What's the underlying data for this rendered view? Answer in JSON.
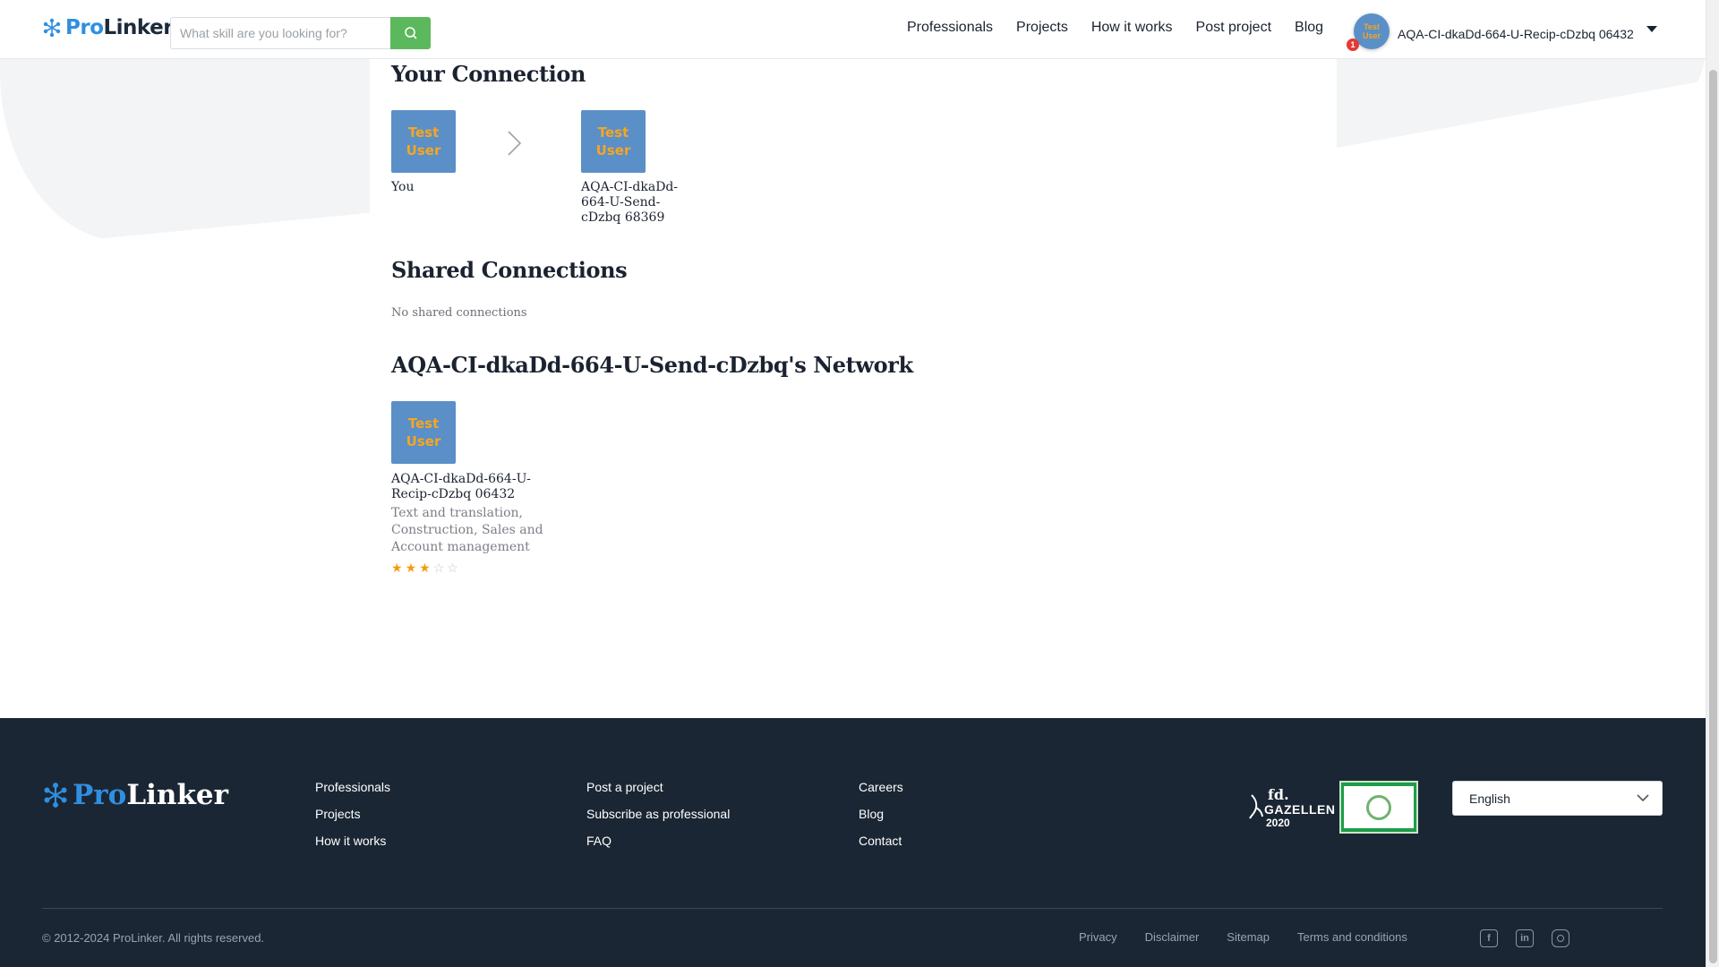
{
  "header": {
    "logo_pro": "Pro",
    "logo_linker": "Linker",
    "search_placeholder": "What skill are you looking for?",
    "nav": [
      "Professionals",
      "Projects",
      "How it works",
      "Post project",
      "Blog"
    ],
    "user_name": "AQA-CI-dkaDd-664-U-Recip-cDzbq 06432",
    "avatar_text": "Test User",
    "notification_count": "1"
  },
  "your_connection": {
    "title": "Your Connection",
    "you_tile": "Test User",
    "you_label": "You",
    "target_tile": "Test User",
    "target_label": "AQA-CI-dkaDd-664-U-Send-cDzbq 68369"
  },
  "shared_connections": {
    "title": "Shared Connections",
    "empty_text": "No shared connections"
  },
  "network": {
    "title": "AQA-CI-dkaDd-664-U-Send-cDzbq's Network",
    "members": [
      {
        "tile": "Test User",
        "name": "AQA-CI-dkaDd-664-U-Recip-cDzbq 06432",
        "skills": "Text and translation, Construction, Sales and Account management",
        "rating": 3,
        "rating_max": 5
      }
    ]
  },
  "footer": {
    "logo_pro": "Pro",
    "logo_linker": "Linker",
    "col1": [
      "Professionals",
      "Projects",
      "How it works"
    ],
    "col2": [
      "Post a project",
      "Subscribe as professional",
      "FAQ"
    ],
    "col3": [
      "Careers",
      "Blog",
      "Contact"
    ],
    "gazellen_fd": "fd.",
    "gazellen_name": "GAZELLEN",
    "gazellen_year": "2020",
    "language": "English",
    "copyright": "© 2012-2024 ProLinker. All rights reserved.",
    "legal": [
      "Privacy",
      "Disclaimer",
      "Sitemap",
      "Terms and conditions"
    ],
    "social_icons": [
      "facebook-icon",
      "linkedin-icon",
      "instagram-icon"
    ]
  },
  "colors": {
    "brand_blue": "#2f8fe0",
    "search_green": "#5cb85c",
    "tile_blue": "#5b8fc7",
    "tile_text": "#f5a623",
    "footer_bg": "#1b2634",
    "star": "#f39c12"
  }
}
